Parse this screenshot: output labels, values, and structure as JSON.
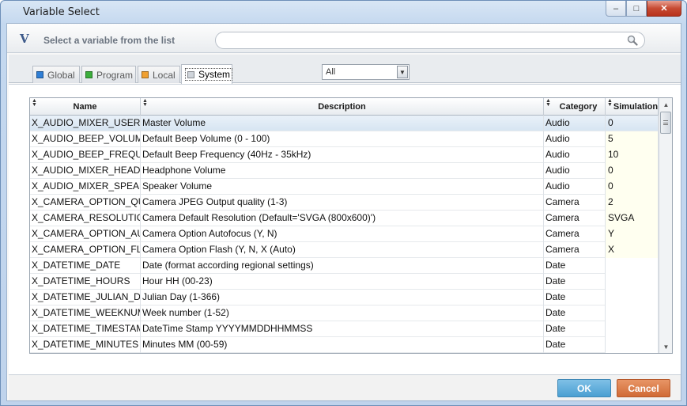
{
  "window": {
    "title": "Variable Select"
  },
  "header": {
    "logo": "V",
    "label": "Select a variable from the list",
    "search_value": ""
  },
  "tabs": [
    {
      "label": "Global",
      "color": "#2f7fd6",
      "active": false
    },
    {
      "label": "Program",
      "color": "#3cae3c",
      "active": false
    },
    {
      "label": "Local",
      "color": "#f0a030",
      "active": false
    },
    {
      "label": "System",
      "color": "#cfd4da",
      "active": true
    }
  ],
  "filter": {
    "selected": "All"
  },
  "table": {
    "columns": [
      "Name",
      "Description",
      "Category",
      "Simulation"
    ],
    "rows": [
      [
        "X_AUDIO_MIXER_USER_VOLUME",
        "Master Volume",
        "Audio",
        "0"
      ],
      [
        "X_AUDIO_BEEP_VOLUME",
        "Default Beep Volume (0 - 100)",
        "Audio",
        "5"
      ],
      [
        "X_AUDIO_BEEP_FREQUENCY",
        "Default Beep Frequency (40Hz - 35kHz)",
        "Audio",
        "10"
      ],
      [
        "X_AUDIO_MIXER_HEADPHONE",
        "Headphone Volume",
        "Audio",
        "0"
      ],
      [
        "X_AUDIO_MIXER_SPEAKER",
        "Speaker Volume",
        "Audio",
        "0"
      ],
      [
        "X_CAMERA_OPTION_QUALITY",
        "Camera JPEG Output quality (1-3)",
        "Camera",
        "2"
      ],
      [
        "X_CAMERA_RESOLUTION",
        "Camera Default Resolution (Default='SVGA (800x600)')",
        "Camera",
        "SVGA"
      ],
      [
        "X_CAMERA_OPTION_AUTOFOCUS",
        "Camera Option Autofocus (Y, N)",
        "Camera",
        "Y"
      ],
      [
        "X_CAMERA_OPTION_FLASH",
        "Camera Option Flash (Y, N, X (Auto)",
        "Camera",
        "X"
      ],
      [
        "X_DATETIME_DATE",
        "Date (format according regional settings)",
        "Date",
        ""
      ],
      [
        "X_DATETIME_HOURS",
        "Hour HH (00-23)",
        "Date",
        ""
      ],
      [
        "X_DATETIME_JULIAN_DAY",
        "Julian Day (1-366)",
        "Date",
        ""
      ],
      [
        "X_DATETIME_WEEKNUMBER",
        "Week number (1-52)",
        "Date",
        ""
      ],
      [
        "X_DATETIME_TIMESTAMP",
        "DateTime Stamp YYYYMMDDHHMMSS",
        "Date",
        ""
      ],
      [
        "X_DATETIME_MINUTES",
        "Minutes MM (00-59)",
        "Date",
        ""
      ]
    ]
  },
  "footer": {
    "ok_label": "OK",
    "cancel_label": "Cancel"
  }
}
